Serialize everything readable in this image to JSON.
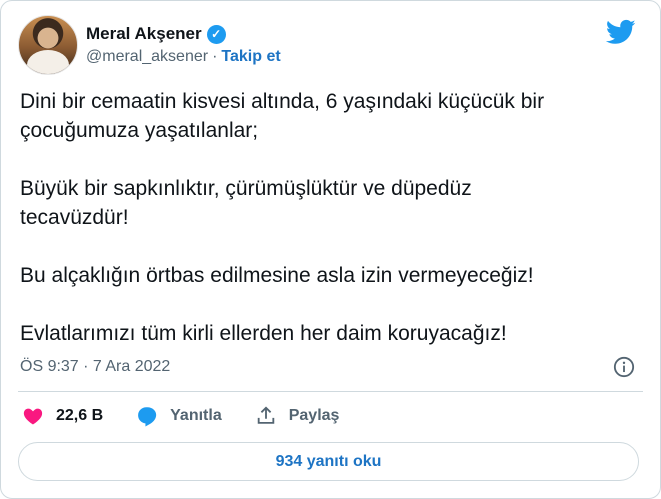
{
  "author": {
    "name": "Meral Akşener",
    "handle": "@meral_aksener",
    "separator": "·",
    "follow_label": "Takip et",
    "verified_glyph": "✓"
  },
  "tweet": {
    "text": "Dini bir cemaatin kisvesi altında, 6 yaşındaki küçücük bir\nçocuğumuza yaşatılanlar;\n\nBüyük bir sapkınlıktır, çürümüşlüktür ve düpedüz\ntecavüzdür!\n\nBu alçaklığın örtbas edilmesine asla izin vermeyeceğiz!\n\nEvlatlarımızı tüm kirli ellerden her daim koruyacağız!",
    "timestamp": "ÖS 9:37 · 7 Ara 2022"
  },
  "actions": {
    "likes": "22,6 B",
    "reply_label": "Yanıtla",
    "share_label": "Paylaş"
  },
  "replies_button": "934 yanıtı oku",
  "colors": {
    "accent": "#1d9bf0",
    "link": "#1d74c4",
    "like": "#f91880",
    "muted": "#536471",
    "border": "#cfd9de"
  },
  "icons": [
    "twitter-bird-icon",
    "verified-badge-icon",
    "info-icon",
    "heart-icon",
    "reply-bubble-icon",
    "share-icon"
  ]
}
